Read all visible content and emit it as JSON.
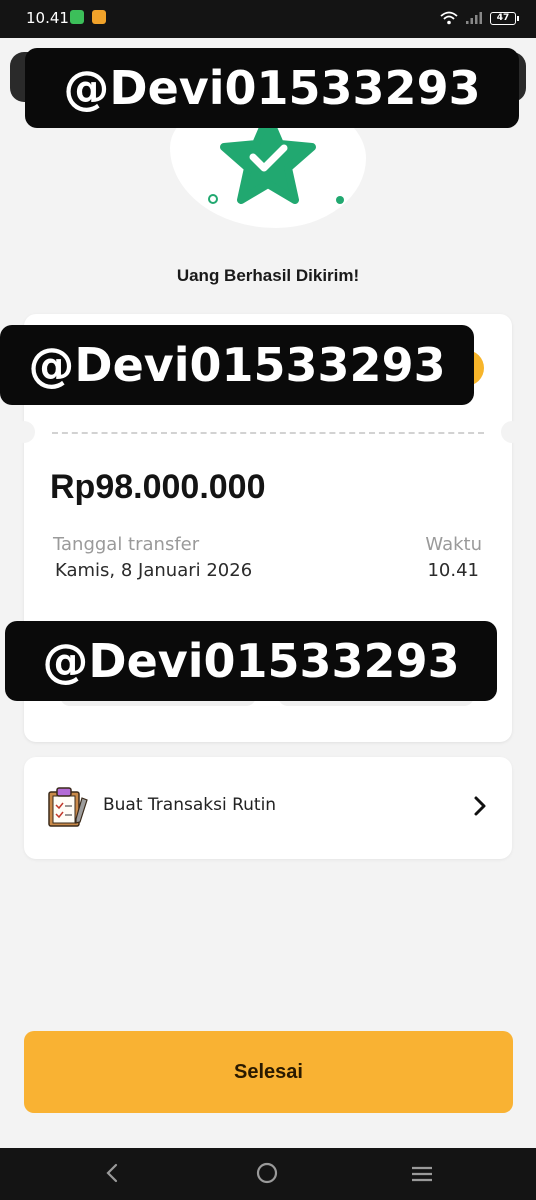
{
  "status_bar": {
    "time": "10.41",
    "battery": "47"
  },
  "hero": {
    "icon": "star-check-icon",
    "accent": "#21a870"
  },
  "title": "Uang Berhasil Dikirim!",
  "transfer": {
    "amount": "Rp98.000.000",
    "date_label": "Tanggal transfer",
    "date_value": "Kamis, 8 Januari 2026",
    "time_label": "Waktu",
    "time_value": "10.41"
  },
  "routine": {
    "label": "Buat Transaksi Rutin",
    "icon": "clipboard-icon"
  },
  "primary_button": {
    "label": "Selesai",
    "color": "#f9b233"
  },
  "watermark": {
    "text": "@Devi01533293"
  },
  "nav": {
    "back": "back-icon",
    "home": "home-icon",
    "menu": "menu-icon"
  }
}
